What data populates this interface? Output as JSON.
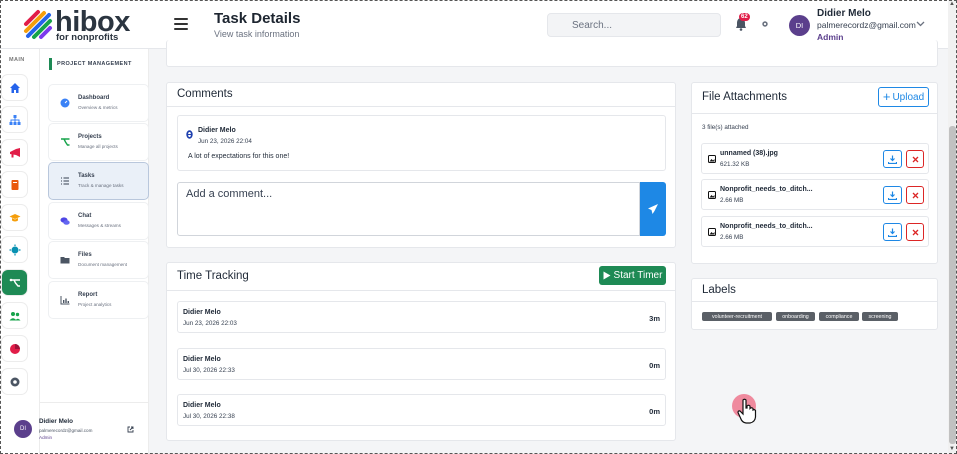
{
  "brand": {
    "name": "hibox",
    "tagline": "for nonprofits",
    "colors": [
      "#e11d48",
      "#f59e0b",
      "#2563eb",
      "#16a34a",
      "#7c3aed"
    ]
  },
  "header": {
    "title": "Task Details",
    "subtitle": "View task information",
    "search_placeholder": "Search...",
    "notification_count": "62",
    "user": {
      "name": "Didier Melo",
      "email": "palmerecordz@gmail.com",
      "role": "Admin",
      "initials": "DI"
    }
  },
  "rail": {
    "label": "MAIN",
    "icons": [
      "home-icon",
      "org-chart-icon",
      "megaphone-icon",
      "book-icon",
      "graduation-cap-icon",
      "virus-icon",
      "project-icon",
      "users-icon",
      "pie-chart-icon",
      "settings-icon"
    ],
    "active": "project-icon"
  },
  "sidebar": {
    "section": "PROJECT MANAGEMENT",
    "items": [
      {
        "title": "Dashboard",
        "subtitle": "Overview & metrics",
        "icon": "dashboard-icon"
      },
      {
        "title": "Projects",
        "subtitle": "Manage all projects",
        "icon": "project-icon"
      },
      {
        "title": "Tasks",
        "subtitle": "Track & manage tasks",
        "icon": "task-list-icon",
        "active": true
      },
      {
        "title": "Chat",
        "subtitle": "Messages & streams",
        "icon": "chat-icon"
      },
      {
        "title": "Files",
        "subtitle": "Document management",
        "icon": "folder-icon"
      },
      {
        "title": "Report",
        "subtitle": "Project analytics",
        "icon": "report-icon"
      }
    ],
    "user": {
      "name": "Didier Melo",
      "email": "palmerecordz@gmail.com",
      "role": "Admin",
      "initials": "DI"
    }
  },
  "comments": {
    "title": "Comments",
    "items": [
      {
        "author": "Didier Melo",
        "date": "Jun 23, 2026 22:04",
        "text": "A lot of expectations for this one!"
      }
    ],
    "input_placeholder": "Add a comment..."
  },
  "time_tracking": {
    "title": "Time Tracking",
    "start_label": "Start Timer",
    "entries": [
      {
        "name": "Didier Melo",
        "date": "Jun 23, 2026 22:03",
        "duration": "3m"
      },
      {
        "name": "Didier Melo",
        "date": "Jul 30, 2026 22:33",
        "duration": "0m"
      },
      {
        "name": "Didier Melo",
        "date": "Jul 30, 2026 22:38",
        "duration": "0m"
      }
    ]
  },
  "files": {
    "title": "File Attachments",
    "upload_label": "Upload",
    "count_text": "3 file(s) attached",
    "items": [
      {
        "name": "unnamed (38).jpg",
        "size": "621.32 KB"
      },
      {
        "name": "Nonprofit_needs_to_ditch...",
        "size": "2.66 MB"
      },
      {
        "name": "Nonprofit_needs_to_ditch...",
        "size": "2.66 MB"
      }
    ]
  },
  "labels": {
    "title": "Labels",
    "items": [
      "volunteer-recruitment",
      "onboarding",
      "compliance",
      "screening"
    ]
  },
  "colors": {
    "accent_green": "#1e8a55",
    "accent_blue": "#1e88e5",
    "danger": "#dc2626",
    "avatar": "#5b3f8c"
  }
}
